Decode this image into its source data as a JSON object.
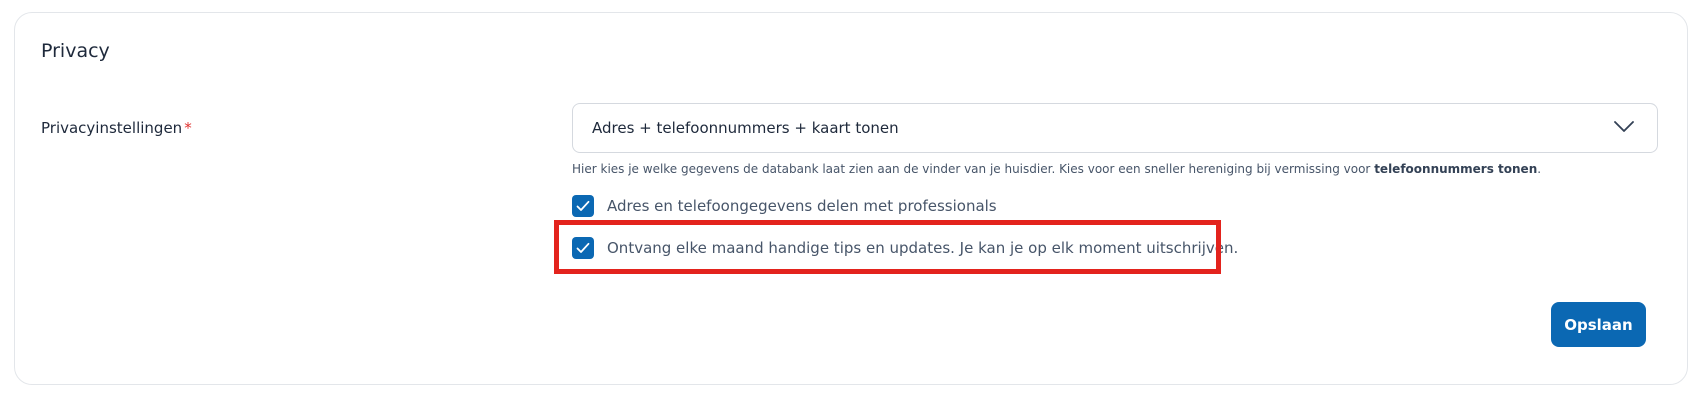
{
  "section": {
    "title": "Privacy"
  },
  "privacy_field": {
    "label": "Privacyinstellingen",
    "required_marker": "*",
    "selected_value": "Adres + telefoonnummers + kaart tonen",
    "help_text_prefix": "Hier kies je welke gegevens de databank laat zien aan de vinder van je huisdier. Kies voor een sneller hereniging bij vermissing voor ",
    "help_text_bold": "telefoonnummers tonen",
    "help_text_suffix": "."
  },
  "checkboxes": [
    {
      "label": "Adres en telefoongegevens delen met professionals",
      "checked": true
    },
    {
      "label": "Ontvang elke maand handige tips en updates. Je kan je op elk moment uitschrijven.",
      "checked": true
    }
  ],
  "actions": {
    "save_label": "Opslaan"
  },
  "colors": {
    "accent": "#0b68b3",
    "required": "#e0312e",
    "highlight": "#e3231d"
  },
  "icons": {
    "dropdown": "chevron-down-icon",
    "check": "checkmark-icon"
  }
}
